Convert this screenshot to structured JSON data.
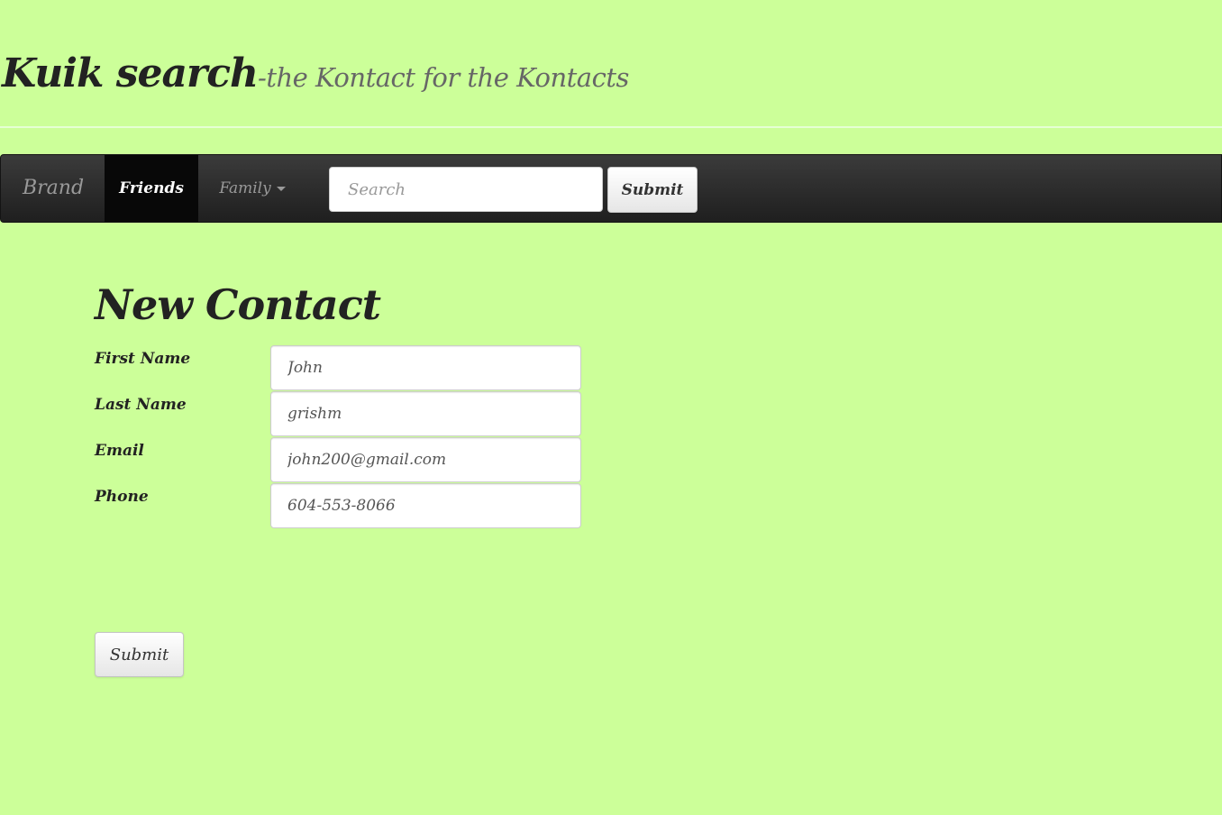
{
  "header": {
    "title": "Kuik search",
    "tagline": "-the Kontact for the Kontacts"
  },
  "navbar": {
    "brand": "Brand",
    "items": [
      {
        "label": "Friends",
        "active": true
      },
      {
        "label": "Family",
        "dropdown": true
      }
    ],
    "search": {
      "placeholder": "Search",
      "value": ""
    },
    "submit_label": "Submit"
  },
  "form": {
    "heading": "New Contact",
    "fields": [
      {
        "label": "First Name",
        "value": "John"
      },
      {
        "label": "Last Name",
        "value": "grishm"
      },
      {
        "label": "Email",
        "value": "john200@gmail.com"
      },
      {
        "label": "Phone",
        "value": "604-553-8066"
      }
    ],
    "submit_label": "Submit"
  },
  "colors": {
    "page_background": "#ccff99",
    "navbar_background": "#222222",
    "active_nav_background": "#080808"
  }
}
